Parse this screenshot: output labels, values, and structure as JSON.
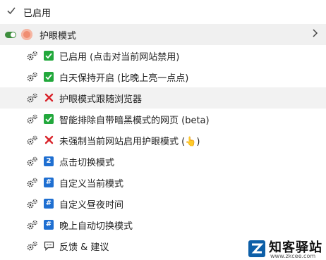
{
  "header": {
    "enabled_label": "已启用"
  },
  "extension": {
    "name": "护眼模式"
  },
  "items": [
    {
      "mark": "check",
      "label": "已启用 (点击对当前网站禁用)"
    },
    {
      "mark": "check",
      "label": "白天保持开启 (比晚上亮一点点)"
    },
    {
      "mark": "cross",
      "label": "护眼模式跟随浏览器"
    },
    {
      "mark": "check",
      "label": "智能排除自带暗黑模式的网页 (beta)"
    },
    {
      "mark": "cross",
      "label": "未强制当前网站启用护眼模式 (👆)"
    },
    {
      "mark": "num",
      "badge": "2",
      "label": "点击切换模式"
    },
    {
      "mark": "num",
      "badge": "#",
      "label": "自定义当前模式"
    },
    {
      "mark": "num",
      "badge": "#",
      "label": "自定义昼夜时间"
    },
    {
      "mark": "num",
      "badge": "#",
      "label": "晚上自动切换模式"
    },
    {
      "mark": "chat",
      "label": "反馈 & 建议"
    }
  ],
  "watermark": {
    "title": "知客驿站",
    "url": "www.zkcee.com"
  },
  "colors": {
    "accent_green": "#22a83c",
    "accent_blue": "#1f6fd1",
    "cross_red": "#d9232a",
    "toggle_green": "#3e8e3e"
  }
}
